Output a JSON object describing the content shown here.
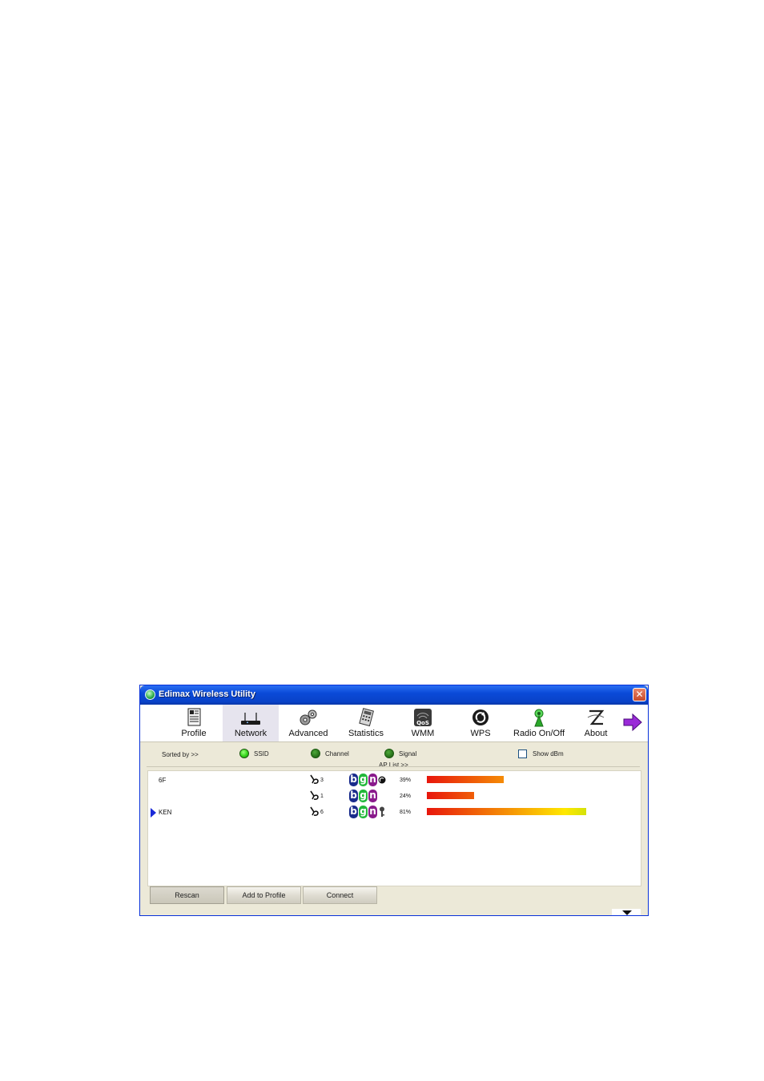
{
  "window": {
    "title": "Edimax Wireless Utility",
    "close_label": "✕"
  },
  "toolbar": {
    "items": [
      {
        "label": "Profile",
        "icon": "profile-icon"
      },
      {
        "label": "Network",
        "icon": "router-icon",
        "active": true
      },
      {
        "label": "Advanced",
        "icon": "gears-icon"
      },
      {
        "label": "Statistics",
        "icon": "statistics-icon"
      },
      {
        "label": "WMM",
        "icon": "qos-icon"
      },
      {
        "label": "WPS",
        "icon": "wps-icon"
      },
      {
        "label": "Radio On/Off",
        "icon": "radio-antenna-icon"
      },
      {
        "label": "About",
        "icon": "about-icon"
      }
    ],
    "next_icon": "purple-arrow-right-icon"
  },
  "sort": {
    "label": "Sorted by >>",
    "options": [
      {
        "label": "SSID",
        "selected": true
      },
      {
        "label": "Channel",
        "selected": false
      },
      {
        "label": "Signal",
        "selected": false
      }
    ],
    "show_dbm": {
      "label": "Show dBm",
      "checked": false
    }
  },
  "ap_list": {
    "label": "AP List >>",
    "rows": [
      {
        "ssid": "6F",
        "channel": "3",
        "modes": [
          "b",
          "g",
          "n"
        ],
        "extra_icon": "wps-small-icon",
        "signal_text": "39%",
        "signal": 39,
        "selected": false
      },
      {
        "ssid": "",
        "channel": "1",
        "modes": [
          "b",
          "g",
          "n"
        ],
        "extra_icon": "",
        "signal_text": "24%",
        "signal": 24,
        "selected": false
      },
      {
        "ssid": "KEN",
        "channel": "6",
        "modes": [
          "b",
          "g",
          "n"
        ],
        "extra_icon": "key-icon",
        "signal_text": "81%",
        "signal": 81,
        "selected": true
      }
    ]
  },
  "buttons": {
    "rescan": "Rescan",
    "add_to_profile": "Add to Profile",
    "connect": "Connect"
  },
  "colors": {
    "title_bar": "#0a4ad8",
    "mode_b": "#1a2c8c",
    "mode_g": "#22b83a",
    "mode_n": "#8a1a8c",
    "signal_start": "#e8160c",
    "signal_mid": "#ffe800",
    "signal_end": "#8ad81a"
  }
}
